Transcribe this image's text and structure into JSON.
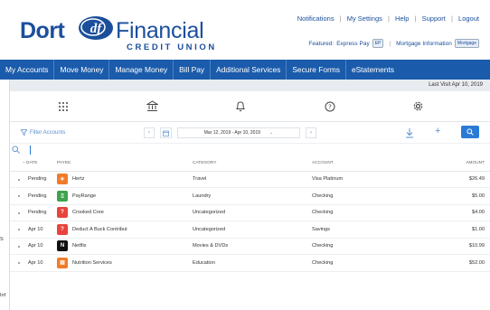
{
  "brand": {
    "name_part1": "Dort",
    "mark": "df",
    "name_part2": "Financial",
    "subtitle": "CREDIT UNION",
    "primary": "#1b5bab",
    "logo_color": "#1b4f9c"
  },
  "toplinks": {
    "notifications": "Notifications",
    "settings": "My Settings",
    "help": "Help",
    "support": "Support",
    "logout": "Logout",
    "separator": "|"
  },
  "featured": {
    "label": "Featured:",
    "express_pay": "Express Pay",
    "express_pay_tag": "EP",
    "mortgage": "Mortgage Information",
    "mortgage_tag": "Mortgage",
    "separator": "|"
  },
  "nav": {
    "items": [
      "My Accounts",
      "Move Money",
      "Manage Money",
      "Bill Pay",
      "Additional Services",
      "Secure Forms",
      "eStatements"
    ]
  },
  "last_visit": "Last Visit Apr 10, 2019",
  "iconbar": {
    "icons": [
      "grid-icon",
      "bank-icon",
      "bell-icon",
      "help-icon",
      "gear-icon"
    ]
  },
  "toolbar": {
    "filter_label": "Filter Accounts",
    "prev": "‹",
    "next": "›",
    "date_range": "Mar 12, 2019 - Apr 10, 2019",
    "date_caret": "⌄",
    "plus": "+"
  },
  "table": {
    "headers": {
      "date": "– DATE",
      "payee": "PAYEE",
      "category": "CATEGORY",
      "account": "ACCOUNT",
      "amount": "AMOUNT"
    },
    "rows": [
      {
        "date": "Pending",
        "payee": "Hertz",
        "category": "Travel",
        "account": "Visa Platinum",
        "amount": "$26.49",
        "icon_color": "#f07c2a",
        "icon_glyph": "✈"
      },
      {
        "date": "Pending",
        "payee": "PayRange",
        "category": "Laundry",
        "account": "Checking",
        "amount": "$5.00",
        "icon_color": "#3fa34d",
        "icon_glyph": "▯"
      },
      {
        "date": "Pending",
        "payee": "Crooked Cree",
        "category": "Uncategorized",
        "account": "Checking",
        "amount": "$4.00",
        "icon_color": "#e8443c",
        "icon_glyph": "?"
      },
      {
        "date": "Apr 10",
        "payee": "Deduct A Buck Contribut",
        "category": "Uncategorized",
        "account": "Savings",
        "amount": "$1.00",
        "icon_color": "#e8443c",
        "icon_glyph": "?"
      },
      {
        "date": "Apr 10",
        "payee": "Netflix",
        "category": "Movies & DVDs",
        "account": "Checking",
        "amount": "$10.99",
        "icon_color": "#111111",
        "icon_glyph": "N"
      },
      {
        "date": "Apr 10",
        "payee": "Nutrition Services",
        "category": "Education",
        "account": "Checking",
        "amount": "$52.00",
        "icon_color": "#f07c2a",
        "icon_glyph": "▤"
      }
    ]
  },
  "left_stubs": [
    "S",
    "Inf"
  ]
}
